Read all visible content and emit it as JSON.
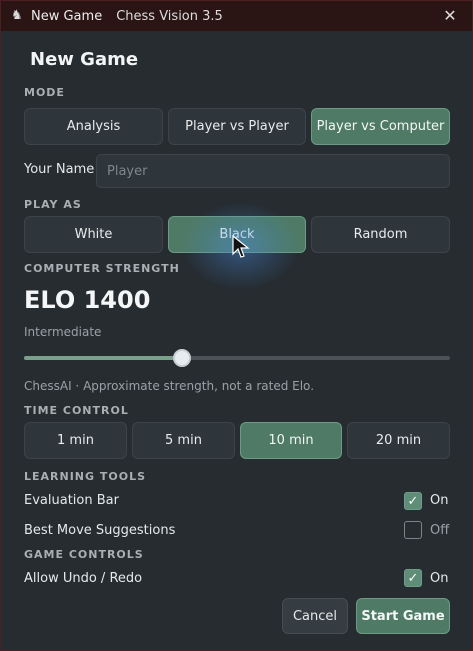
{
  "titlebar": {
    "title": "New Game",
    "app_name": "Chess Vision 3.5",
    "icon": "chess-knight-icon",
    "close_icon": "close-icon"
  },
  "dialog": {
    "title": "New Game"
  },
  "mode": {
    "label": "MODE",
    "options": [
      "Analysis",
      "Player vs Player",
      "Player vs Computer"
    ],
    "selected": "Player vs Computer"
  },
  "name": {
    "label": "Your Name",
    "placeholder": "Player",
    "value": ""
  },
  "play_as": {
    "label": "PLAY AS",
    "options": [
      "White",
      "Black",
      "Random"
    ],
    "selected": "Black"
  },
  "strength": {
    "label": "COMPUTER STRENGTH",
    "elo_text": "ELO 1400",
    "level": "Intermediate",
    "slider_fraction": 0.37,
    "note": "ChessAI · Approximate strength, not a rated Elo."
  },
  "time_control": {
    "label": "TIME CONTROL",
    "options": [
      "1 min",
      "5 min",
      "10 min",
      "20 min"
    ],
    "selected": "10 min"
  },
  "learning_tools": {
    "label": "LEARNING TOOLS",
    "items": [
      {
        "label": "Evaluation Bar",
        "checked": true,
        "state": "On"
      },
      {
        "label": "Best Move Suggestions",
        "checked": false,
        "state": "Off"
      }
    ]
  },
  "game_controls": {
    "label": "GAME CONTROLS",
    "items": [
      {
        "label": "Allow Undo / Redo",
        "checked": true,
        "state": "On"
      }
    ]
  },
  "footer": {
    "cancel": "Cancel",
    "start": "Start Game"
  },
  "colors": {
    "accent": "#4e7a66",
    "background": "#262c30",
    "button": "#2f363b"
  }
}
